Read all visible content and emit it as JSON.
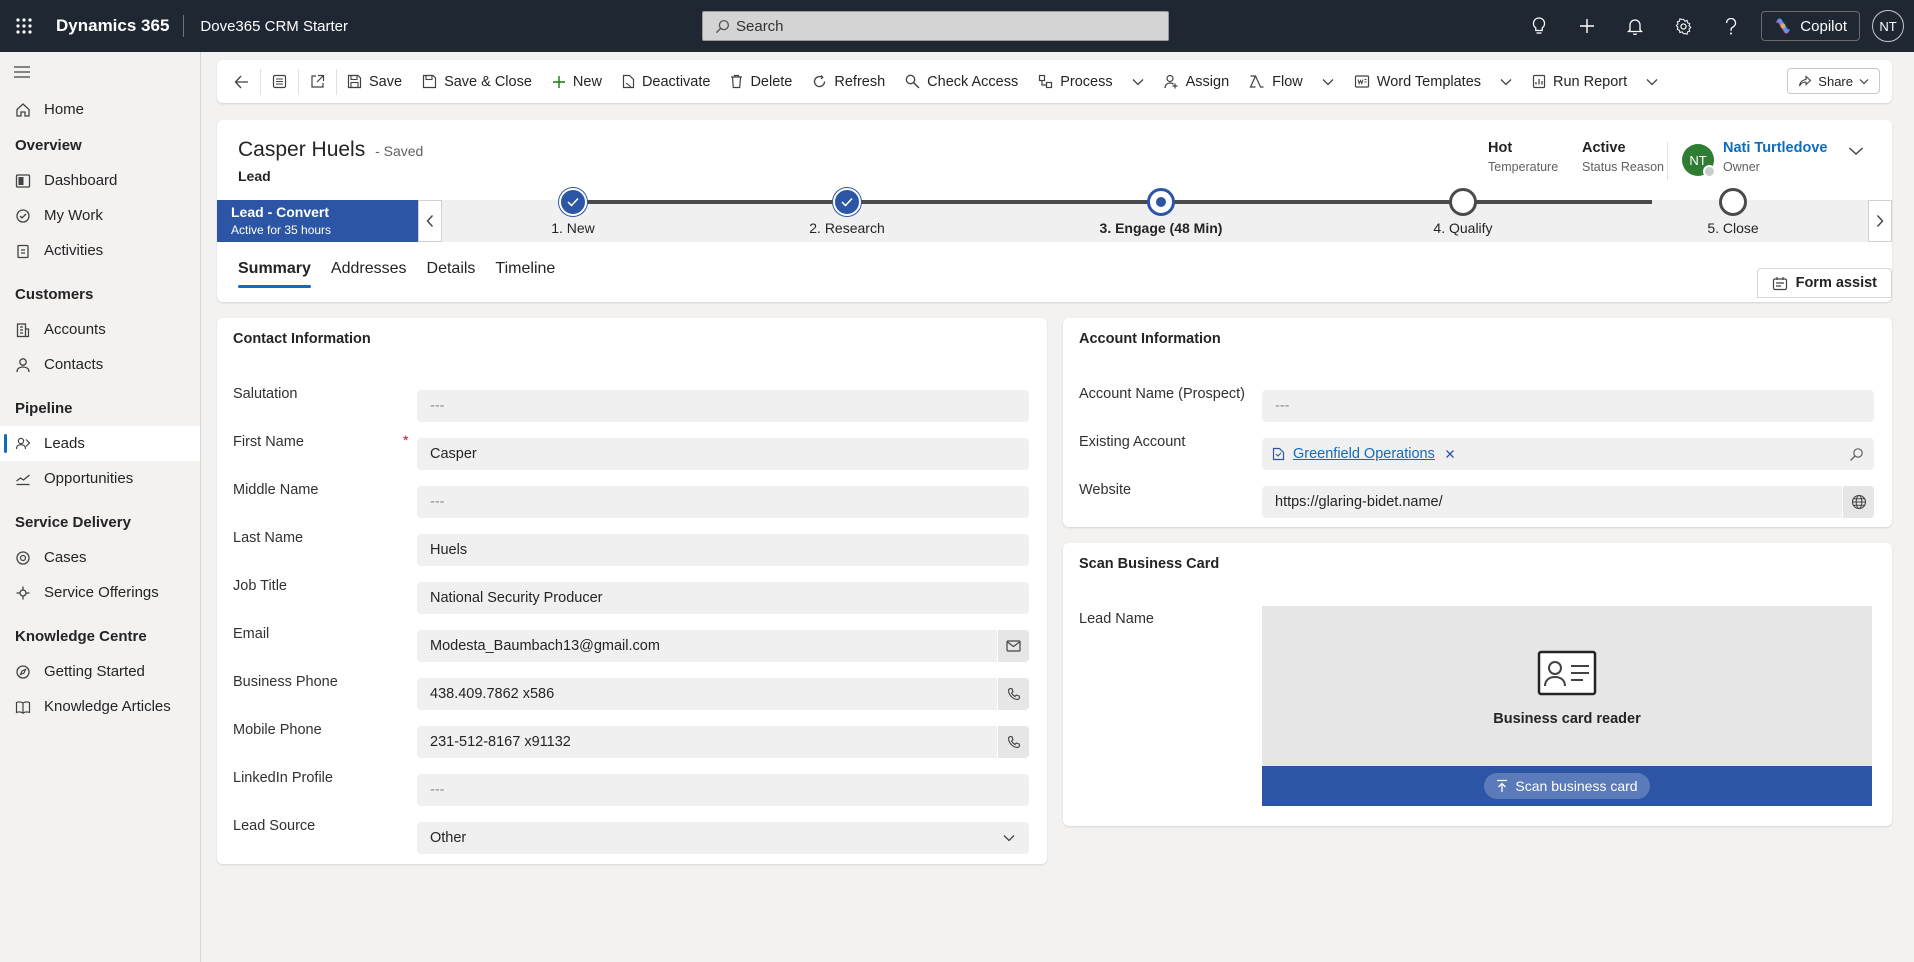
{
  "topbar": {
    "app_name": "Dynamics 365",
    "env_name": "Dove365 CRM Starter",
    "search_placeholder": "Search",
    "copilot_label": "Copilot",
    "user_initials": "NT"
  },
  "sidebar": {
    "home": "Home",
    "groups": [
      {
        "title": "Overview",
        "items": [
          "Dashboard",
          "My Work",
          "Activities"
        ]
      },
      {
        "title": "Customers",
        "items": [
          "Accounts",
          "Contacts"
        ]
      },
      {
        "title": "Pipeline",
        "items": [
          "Leads",
          "Opportunities"
        ]
      },
      {
        "title": "Service Delivery",
        "items": [
          "Cases",
          "Service Offerings"
        ]
      },
      {
        "title": "Knowledge Centre",
        "items": [
          "Getting Started",
          "Knowledge Articles"
        ]
      }
    ],
    "active_item": "Leads"
  },
  "commands": {
    "save": "Save",
    "save_close": "Save & Close",
    "new": "New",
    "deactivate": "Deactivate",
    "delete": "Delete",
    "refresh": "Refresh",
    "check_access": "Check Access",
    "process": "Process",
    "assign": "Assign",
    "flow": "Flow",
    "word_templates": "Word Templates",
    "run_report": "Run Report",
    "share": "Share"
  },
  "record": {
    "name": "Casper Huels",
    "saved": "- Saved",
    "entity": "Lead",
    "header_fields": [
      {
        "value": "Hot",
        "label": "Temperature"
      },
      {
        "value": "Active",
        "label": "Status Reason"
      }
    ],
    "owner": {
      "initials": "NT",
      "name": "Nati Turtledove",
      "label": "Owner"
    }
  },
  "bpf": {
    "title": "Lead - Convert",
    "subtitle": "Active for 35 hours",
    "stages": [
      {
        "label": "1. New",
        "status": "done"
      },
      {
        "label": "2. Research",
        "status": "done"
      },
      {
        "label": "3. Engage  (48 Min)",
        "status": "current"
      },
      {
        "label": "4. Qualify",
        "status": "todo"
      },
      {
        "label": "5. Close",
        "status": "todo"
      }
    ]
  },
  "tabs": [
    "Summary",
    "Addresses",
    "Details",
    "Timeline"
  ],
  "form_assist": "Form assist",
  "contact": {
    "title": "Contact Information",
    "required_mark": "*",
    "fields": [
      {
        "label": "Salutation",
        "value": "---",
        "empty": true
      },
      {
        "label": "First Name",
        "value": "Casper",
        "required": true
      },
      {
        "label": "Middle Name",
        "value": "---",
        "empty": true
      },
      {
        "label": "Last Name",
        "value": "Huels"
      },
      {
        "label": "Job Title",
        "value": "National Security Producer"
      },
      {
        "label": "Email",
        "value": "Modesta_Baumbach13@gmail.com",
        "button": "mail-icon"
      },
      {
        "label": "Business Phone",
        "value": "438.409.7862 x586",
        "button": "phone-icon"
      },
      {
        "label": "Mobile Phone",
        "value": "231-512-8167 x91132",
        "button": "phone-icon"
      },
      {
        "label": "LinkedIn Profile",
        "value": "---",
        "empty": true
      },
      {
        "label": "Lead Source",
        "value": "Other",
        "button": "chevron-down-icon"
      }
    ]
  },
  "account": {
    "title": "Account Information",
    "account_name_label": "Account Name (Prospect)",
    "account_name_value": "---",
    "existing_account_label": "Existing Account",
    "existing_account_value": "Greenfield Operations",
    "website_label": "Website",
    "website_value": "https://glaring-bidet.name/"
  },
  "business_card": {
    "title": "Scan Business Card",
    "lead_name_label": "Lead Name",
    "reader_label": "Business card reader",
    "scan_button": "Scan business card"
  },
  "colors": {
    "accent": "#2c55a6",
    "link": "#0f6cbd",
    "topbar": "#1f2733",
    "owner_avatar": "#2f7d32"
  }
}
